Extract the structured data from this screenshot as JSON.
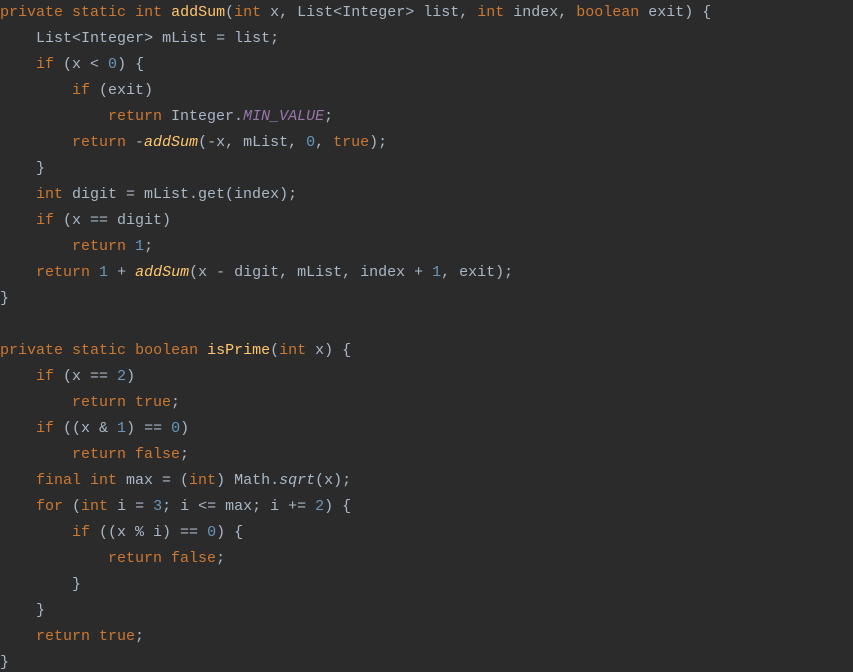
{
  "code": {
    "lines": [
      {
        "i": 0,
        "tokens": [
          [
            "kw",
            "private"
          ],
          [
            "punct",
            " "
          ],
          [
            "kw",
            "static"
          ],
          [
            "punct",
            " "
          ],
          [
            "kw",
            "int"
          ],
          [
            "punct",
            " "
          ],
          [
            "fn",
            "addSum"
          ],
          [
            "punct",
            "("
          ],
          [
            "kw",
            "int"
          ],
          [
            "punct",
            " x, "
          ],
          [
            "type",
            "List"
          ],
          [
            "punct",
            "<"
          ],
          [
            "type",
            "Integer"
          ],
          [
            "punct",
            "> list, "
          ],
          [
            "kw",
            "int"
          ],
          [
            "punct",
            " index, "
          ],
          [
            "kw",
            "boolean"
          ],
          [
            "punct",
            " exit) {"
          ]
        ]
      },
      {
        "i": 1,
        "tokens": [
          [
            "punct",
            "    "
          ],
          [
            "type",
            "List"
          ],
          [
            "punct",
            "<"
          ],
          [
            "type",
            "Integer"
          ],
          [
            "punct",
            "> mList = list;"
          ]
        ]
      },
      {
        "i": 2,
        "tokens": [
          [
            "punct",
            "    "
          ],
          [
            "kw",
            "if"
          ],
          [
            "punct",
            " (x < "
          ],
          [
            "num",
            "0"
          ],
          [
            "punct",
            ") {"
          ]
        ]
      },
      {
        "i": 3,
        "tokens": [
          [
            "punct",
            "        "
          ],
          [
            "kw",
            "if"
          ],
          [
            "punct",
            " (exit)"
          ]
        ]
      },
      {
        "i": 4,
        "tokens": [
          [
            "punct",
            "            "
          ],
          [
            "kw",
            "return"
          ],
          [
            "punct",
            " Integer."
          ],
          [
            "const",
            "MIN_VALUE"
          ],
          [
            "punct",
            ";"
          ]
        ]
      },
      {
        "i": 5,
        "tokens": [
          [
            "punct",
            "        "
          ],
          [
            "kw",
            "return"
          ],
          [
            "punct",
            " -"
          ],
          [
            "fncall-italic",
            "addSum"
          ],
          [
            "punct",
            "(-x, mList, "
          ],
          [
            "num",
            "0"
          ],
          [
            "punct",
            ", "
          ],
          [
            "kw",
            "true"
          ],
          [
            "punct",
            ");"
          ]
        ]
      },
      {
        "i": 6,
        "tokens": [
          [
            "punct",
            "    }"
          ]
        ]
      },
      {
        "i": 7,
        "tokens": [
          [
            "punct",
            "    "
          ],
          [
            "kw",
            "int"
          ],
          [
            "punct",
            " digit = mList.get(index);"
          ]
        ]
      },
      {
        "i": 8,
        "tokens": [
          [
            "punct",
            "    "
          ],
          [
            "kw",
            "if"
          ],
          [
            "punct",
            " (x == digit)"
          ]
        ]
      },
      {
        "i": 9,
        "tokens": [
          [
            "punct",
            "        "
          ],
          [
            "kw",
            "return"
          ],
          [
            "punct",
            " "
          ],
          [
            "num",
            "1"
          ],
          [
            "punct",
            ";"
          ]
        ]
      },
      {
        "i": 10,
        "tokens": [
          [
            "punct",
            "    "
          ],
          [
            "kw",
            "return"
          ],
          [
            "punct",
            " "
          ],
          [
            "num",
            "1"
          ],
          [
            "punct",
            " + "
          ],
          [
            "fncall-italic",
            "addSum"
          ],
          [
            "punct",
            "(x - digit, mList, index + "
          ],
          [
            "num",
            "1"
          ],
          [
            "punct",
            ", exit);"
          ]
        ]
      },
      {
        "i": 11,
        "tokens": [
          [
            "punct",
            "}"
          ]
        ]
      },
      {
        "i": 12,
        "tokens": [
          [
            "punct",
            ""
          ]
        ]
      },
      {
        "i": 13,
        "tokens": [
          [
            "kw",
            "private"
          ],
          [
            "punct",
            " "
          ],
          [
            "kw",
            "static"
          ],
          [
            "punct",
            " "
          ],
          [
            "kw",
            "boolean"
          ],
          [
            "punct",
            " "
          ],
          [
            "fn",
            "isPrime"
          ],
          [
            "punct",
            "("
          ],
          [
            "kw",
            "int"
          ],
          [
            "punct",
            " x) {"
          ]
        ]
      },
      {
        "i": 14,
        "tokens": [
          [
            "punct",
            "    "
          ],
          [
            "kw",
            "if"
          ],
          [
            "punct",
            " (x == "
          ],
          [
            "num",
            "2"
          ],
          [
            "punct",
            ")"
          ]
        ]
      },
      {
        "i": 15,
        "tokens": [
          [
            "punct",
            "        "
          ],
          [
            "kw",
            "return true"
          ],
          [
            "punct",
            ";"
          ]
        ]
      },
      {
        "i": 16,
        "tokens": [
          [
            "punct",
            "    "
          ],
          [
            "kw",
            "if"
          ],
          [
            "punct",
            " ((x & "
          ],
          [
            "num",
            "1"
          ],
          [
            "punct",
            ") == "
          ],
          [
            "num",
            "0"
          ],
          [
            "punct",
            ")"
          ]
        ]
      },
      {
        "i": 17,
        "tokens": [
          [
            "punct",
            "        "
          ],
          [
            "kw",
            "return false"
          ],
          [
            "punct",
            ";"
          ]
        ]
      },
      {
        "i": 18,
        "tokens": [
          [
            "punct",
            "    "
          ],
          [
            "kw",
            "final int"
          ],
          [
            "punct",
            " max = ("
          ],
          [
            "kw",
            "int"
          ],
          [
            "punct",
            ") Math."
          ],
          [
            "ital",
            "sqrt"
          ],
          [
            "punct",
            "(x);"
          ]
        ]
      },
      {
        "i": 19,
        "tokens": [
          [
            "punct",
            "    "
          ],
          [
            "kw",
            "for"
          ],
          [
            "punct",
            " ("
          ],
          [
            "kw",
            "int"
          ],
          [
            "punct",
            " i = "
          ],
          [
            "num",
            "3"
          ],
          [
            "punct",
            "; i <= max; i += "
          ],
          [
            "num",
            "2"
          ],
          [
            "punct",
            ") {"
          ]
        ]
      },
      {
        "i": 20,
        "tokens": [
          [
            "punct",
            "        "
          ],
          [
            "kw",
            "if"
          ],
          [
            "punct",
            " ((x % i) == "
          ],
          [
            "num",
            "0"
          ],
          [
            "punct",
            ") {"
          ]
        ]
      },
      {
        "i": 21,
        "tokens": [
          [
            "punct",
            "            "
          ],
          [
            "kw",
            "return false"
          ],
          [
            "punct",
            ";"
          ]
        ]
      },
      {
        "i": 22,
        "tokens": [
          [
            "punct",
            "        }"
          ]
        ]
      },
      {
        "i": 23,
        "tokens": [
          [
            "punct",
            "    }"
          ]
        ]
      },
      {
        "i": 24,
        "tokens": [
          [
            "punct",
            "    "
          ],
          [
            "kw",
            "return true"
          ],
          [
            "punct",
            ";"
          ]
        ]
      },
      {
        "i": 25,
        "tokens": [
          [
            "punct",
            "}"
          ]
        ]
      }
    ]
  }
}
